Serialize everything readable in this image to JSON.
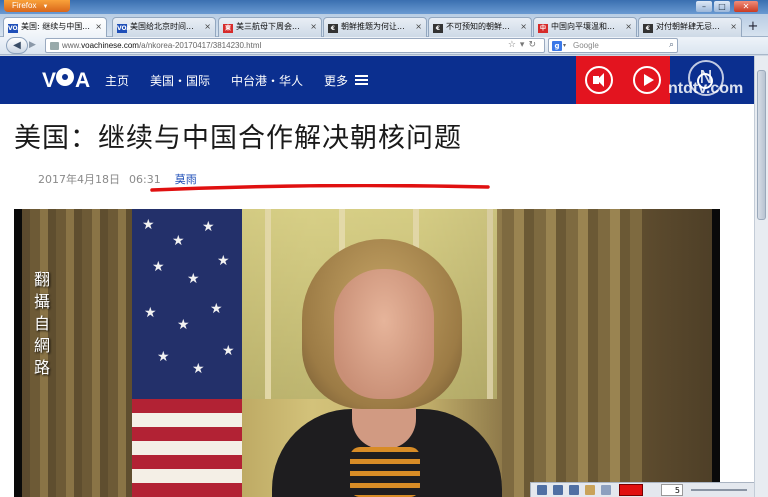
{
  "browser": {
    "menu_button": "Firefox",
    "window_controls": [
      "–",
      "□",
      "✕"
    ],
    "tabs": [
      {
        "label": "美国: 继续与中国...",
        "favicon": "VOA",
        "color": "#1f4fb8",
        "active": true
      },
      {
        "label": "美国给北京时间...",
        "favicon": "VOA",
        "color": "#1f4fb8",
        "active": false
      },
      {
        "label": "美三航母下周会...",
        "favicon": "東",
        "color": "#d62b2b",
        "active": false
      },
      {
        "label": "朝鲜推题为何让...",
        "favicon": "€",
        "color": "#333333",
        "active": false
      },
      {
        "label": "不可预知的朝鲜...",
        "favicon": "€",
        "color": "#333333",
        "active": false
      },
      {
        "label": "中国向平壤温和...",
        "favicon": "中",
        "color": "#d62b2b",
        "active": false
      },
      {
        "label": "对付朝鲜肆无忌...",
        "favicon": "€",
        "color": "#333333",
        "active": false
      }
    ],
    "new_tab": "+",
    "url_prefix": "www.",
    "url_domain": "voachinese.com",
    "url_path": "/a/nkorea-20170417/3814230.html",
    "search_placeholder": "Google",
    "search_engine_icon": "g",
    "nav_icons": {
      "back": "back-arrow-icon",
      "forward": "forward-arrow-icon",
      "bookmark": "star-icon",
      "reload": "reload-icon"
    }
  },
  "site": {
    "logo": "VOA",
    "nav": [
      "主页",
      "美国・国际",
      "中台港・华人",
      "更多"
    ],
    "brand_blue": "#0b2f8f",
    "brand_red": "#e3141f"
  },
  "watermark": {
    "symbol": "N",
    "text": "ntdtv.com"
  },
  "article": {
    "headline": "美国：继续与中国合作解决朝核问题",
    "date": "2017年4月18日",
    "time": "06:31",
    "author": "莫雨"
  },
  "video": {
    "caption": [
      "翻",
      "攝",
      "自",
      "網",
      "路"
    ]
  },
  "statusbar": {
    "zoom_value": "5"
  }
}
